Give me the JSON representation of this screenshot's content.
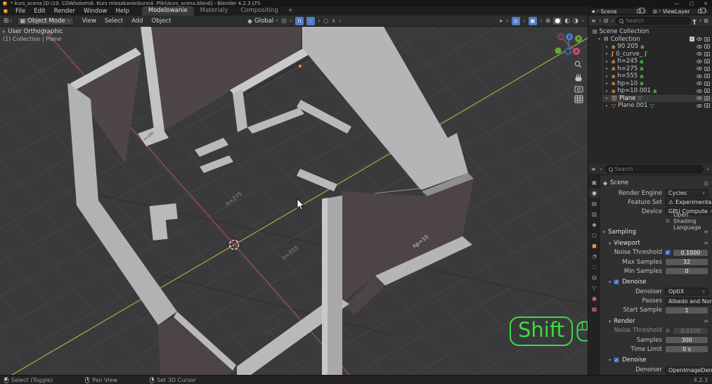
{
  "window": {
    "title": "* kurs_scena [D:\\10. CGWisdom\\6. Kurs mieszkanie\\kurs\\4. Pliki\\kurs_scena.blend] - Blender 4.2.3 LTS",
    "minimize": "—",
    "maximize": "▢",
    "close": "×"
  },
  "menubar": {
    "menus": [
      {
        "label": "File"
      },
      {
        "label": "Edit"
      },
      {
        "label": "Render"
      },
      {
        "label": "Window"
      },
      {
        "label": "Help"
      }
    ],
    "workspaces": [
      {
        "label": "Modelowanie"
      },
      {
        "label": "Materialy"
      },
      {
        "label": "Compositing"
      }
    ],
    "add_workspace": "+"
  },
  "topbar": {
    "scene": "Scene",
    "view_layer": "ViewLayer"
  },
  "toolbar": {
    "mode": "Object Mode",
    "menus": [
      {
        "label": "View"
      },
      {
        "label": "Select"
      },
      {
        "label": "Add"
      },
      {
        "label": "Object"
      }
    ],
    "orientation": "Global"
  },
  "viewport": {
    "overlay_line1": "User Orthographic",
    "overlay_line2": "(1) Collection | Plane",
    "axis_gizmo": {
      "x": "X",
      "y": "Y",
      "z": "Z"
    },
    "floor_labels": {
      "l1": "h=245",
      "l2": "h=275",
      "l3": "h=555",
      "l4": "hp=10",
      "l5": "hp=10"
    },
    "screencast_key": "Shift"
  },
  "outliner": {
    "search_placeholder": "Search",
    "scene_collection": "Scene Collection",
    "collection": "Collection",
    "items": [
      {
        "name": "90 205",
        "type": "font"
      },
      {
        "name": "0_curve_",
        "type": "curve"
      },
      {
        "name": "h=245",
        "type": "font"
      },
      {
        "name": "h=275",
        "type": "font"
      },
      {
        "name": "h=555",
        "type": "font"
      },
      {
        "name": "hp=10",
        "type": "font"
      },
      {
        "name": "hp=10.001",
        "type": "font"
      },
      {
        "name": "Plane",
        "type": "mesh",
        "selected": true
      },
      {
        "name": "Plane.001",
        "type": "mesh"
      }
    ]
  },
  "properties": {
    "search_placeholder": "Search",
    "breadcrumb": "Scene",
    "render_engine_label": "Render Engine",
    "render_engine": "Cycles",
    "feature_set_label": "Feature Set",
    "feature_set": "Experimental",
    "device_label": "Device",
    "device": "GPU Compute",
    "osl_label": "Open Shading Language",
    "sampling_title": "Sampling",
    "viewport_title": "Viewport",
    "vp_noise_threshold_label": "Noise Threshold",
    "vp_noise_threshold": "0.1000",
    "max_samples_label": "Max Samples",
    "max_samples": "32",
    "min_samples_label": "Min Samples",
    "min_samples": "0",
    "denoise_title": "Denoise",
    "vp_denoiser_label": "Denoiser",
    "vp_denoiser": "OptiX",
    "passes_label": "Passes",
    "passes": "Albedo and Normal",
    "start_sample_label": "Start Sample",
    "start_sample": "1",
    "render_title": "Render",
    "r_noise_threshold_label": "Noise Threshold",
    "r_noise_threshold": "0.0100",
    "samples_label": "Samples",
    "samples": "300",
    "time_limit_label": "Time Limit",
    "time_limit": "0 s",
    "r_denoiser_label": "Denoiser",
    "r_denoiser": "OpenImageDenoise"
  },
  "statusbar": {
    "left": "Select (Toggle)",
    "middle": "Pan View",
    "right": "Set 3D Cursor",
    "version": "4.2.3"
  },
  "ui": {
    "chevron": "∨",
    "collapse": "▾",
    "expand": "▸",
    "menu": "≡",
    "warning": "⚠",
    "check": "✓",
    "pin": "◎",
    "editor_icon": "⊞",
    "list_icon": "≡",
    "display_icon": "⊟",
    "cube_icon": "▦",
    "pivot_icon": "◎",
    "magnet_icon": "∩",
    "falloff_icon": "∧",
    "prop_icon": "○",
    "gizmo_icon": "➤",
    "overlay_icon": "◎",
    "xray_icon": "▣",
    "wireframe_icon": "⊕",
    "solid_icon": "●",
    "material_icon": "◐",
    "rendered_icon": "◑",
    "font_icon": "a",
    "curve_icon": "ʃ",
    "mesh_icon": "▽",
    "collection_icon": "▤",
    "scene_icon": "◆",
    "tab_tool": "▣",
    "tab_render": "◉",
    "tab_output": "▤",
    "tab_viewlayer": "▥",
    "tab_scene": "◆",
    "tab_world": "○",
    "tab_object": "◼",
    "tab_modifier": "◔",
    "tab_physics": "◌",
    "tab_constraint": "◍",
    "tab_data": "▽",
    "tab_material": "●",
    "tab_texture": "▦"
  },
  "colors": {
    "accent": "#4772b3",
    "screencast_green": "#3fd944",
    "axis_x": "#aa4a66",
    "axis_y": "#a2b03a",
    "object_icon": "#dd9b54",
    "data_icon": "#58c158"
  }
}
